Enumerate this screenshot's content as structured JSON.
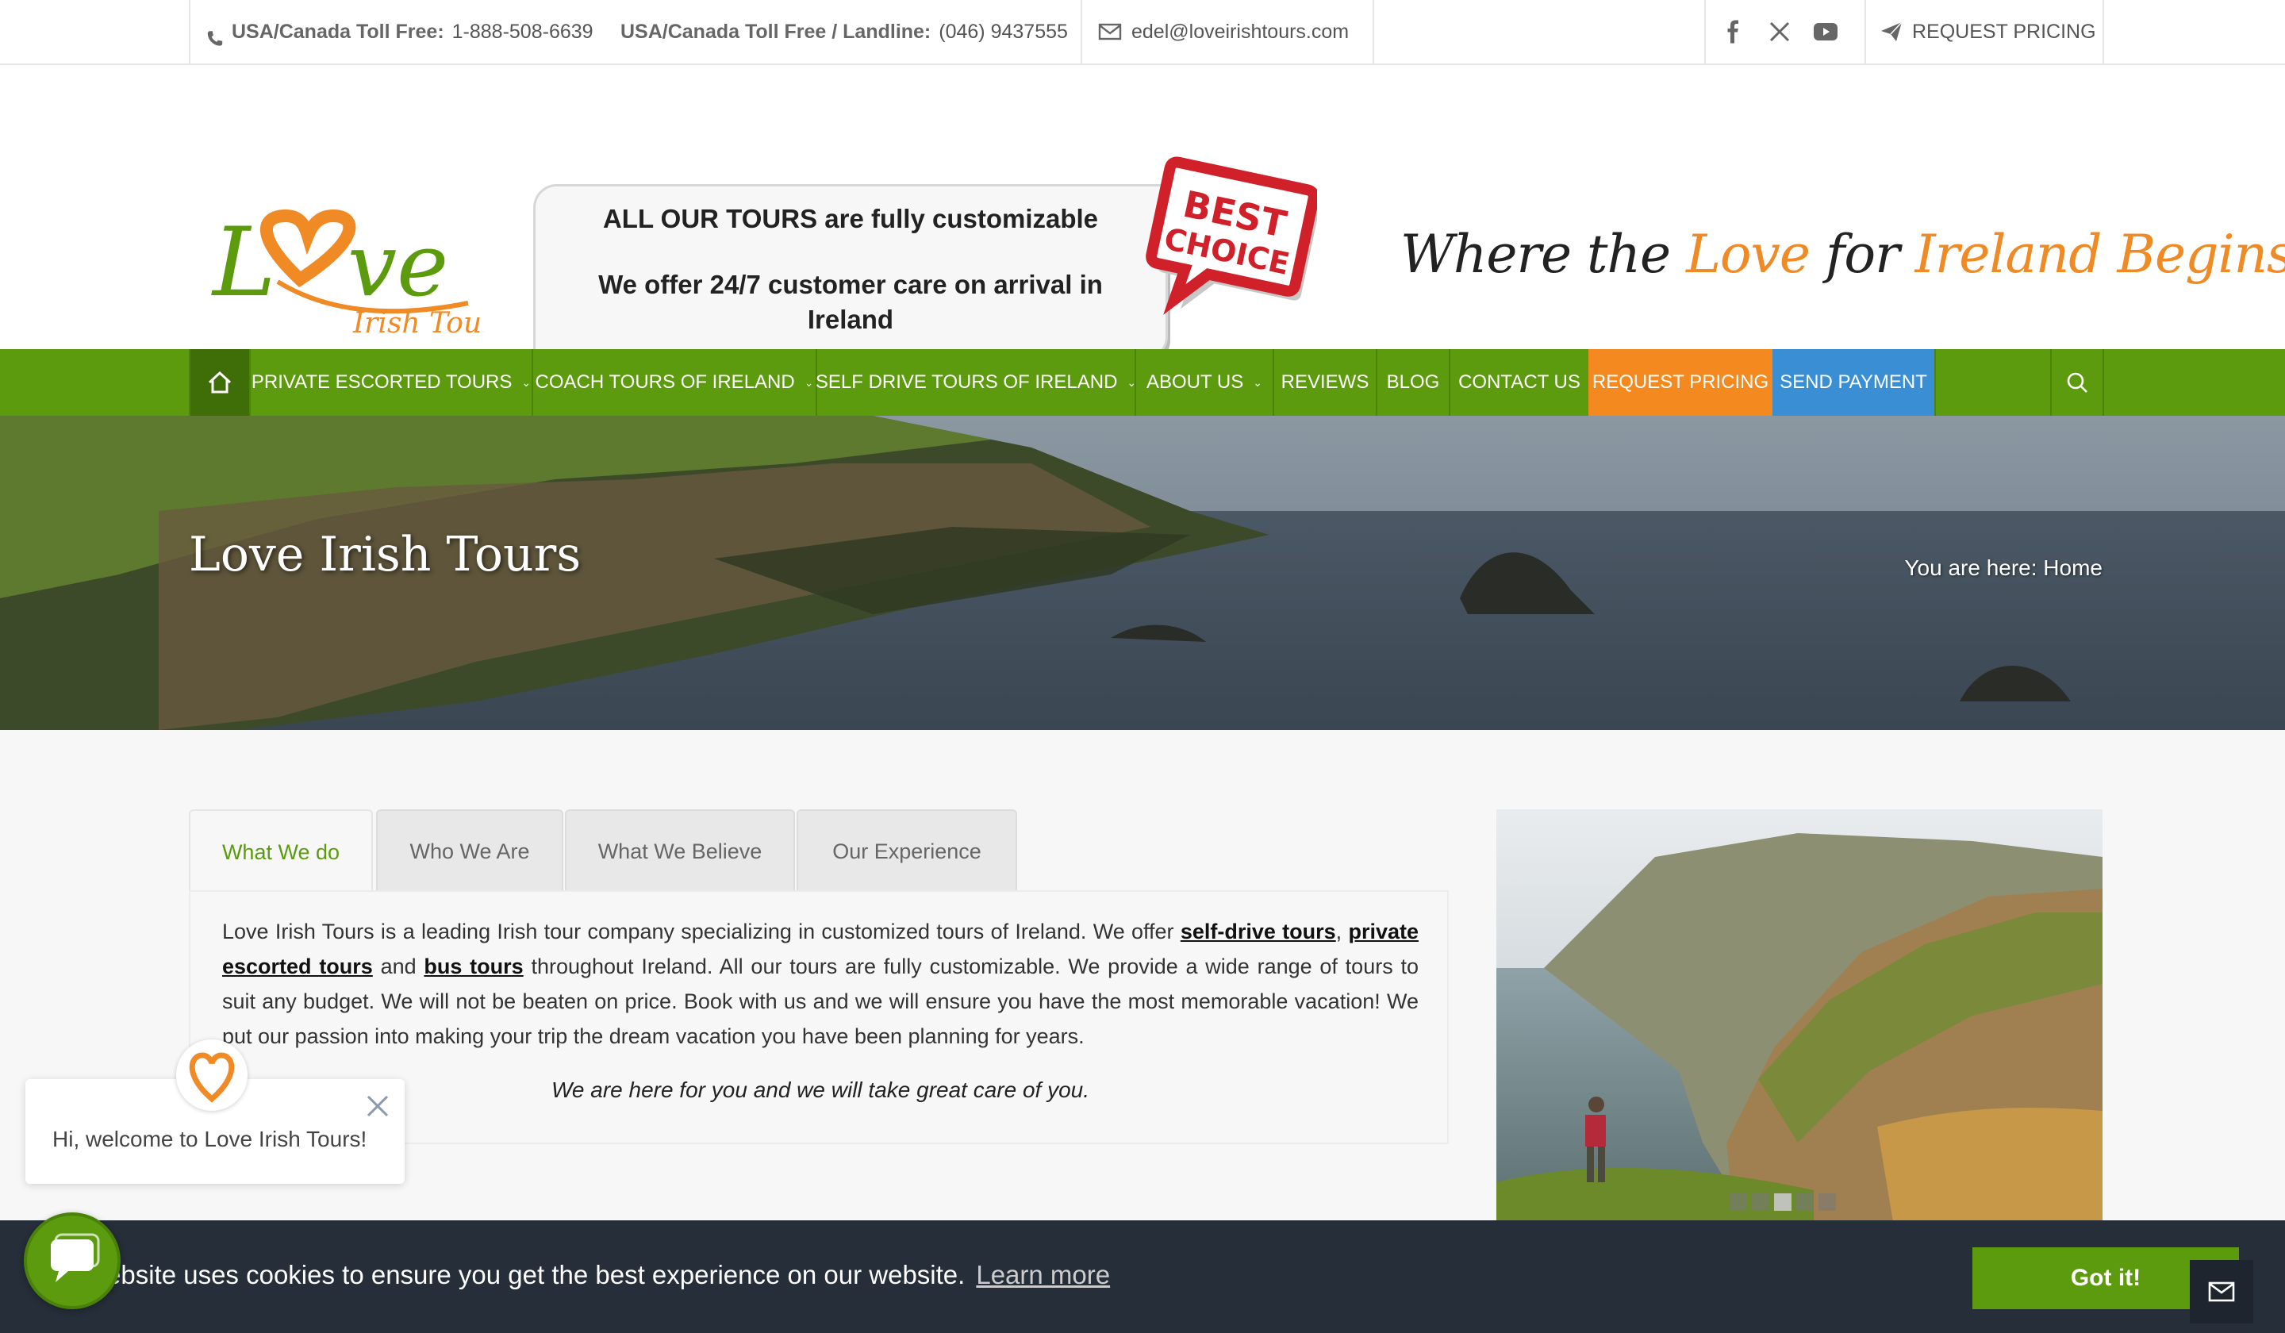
{
  "topbar": {
    "tollfree_label": "USA/Canada Toll Free:",
    "tollfree_number": "1-888-508-6639",
    "landline_label": "USA/Canada Toll Free / Landline:",
    "landline_number": "(046) 9437555",
    "email": "edel@loveirishtours.com",
    "social": [
      "facebook-icon",
      "x-icon",
      "youtube-icon"
    ],
    "request_pricing": "REQUEST PRICING"
  },
  "header": {
    "logo_word": "Love",
    "logo_sub": "Irish Tours",
    "badge_line1": "ALL OUR TOURS are fully customizable",
    "badge_line2": "We offer 24/7 customer care on arrival in Ireland",
    "best_choice_line1": "BEST",
    "best_choice_line2": "CHOICE",
    "tagline_part1": "Where the ",
    "tagline_part2": "Love",
    "tagline_part3": " for ",
    "tagline_part4": "Ireland Begins"
  },
  "nav": {
    "items": [
      {
        "label": "PRIVATE ESCORTED TOURS",
        "dropdown": true
      },
      {
        "label": "COACH TOURS OF IRELAND",
        "dropdown": true
      },
      {
        "label": "SELF DRIVE TOURS OF IRELAND",
        "dropdown": true
      },
      {
        "label": "ABOUT US",
        "dropdown": true
      },
      {
        "label": "REVIEWS"
      },
      {
        "label": "BLOG"
      },
      {
        "label": "CONTACT US"
      },
      {
        "label": "REQUEST PRICING"
      },
      {
        "label": "SEND PAYMENT"
      }
    ]
  },
  "hero": {
    "title": "Love Irish Tours",
    "breadcrumb": "You are here: Home"
  },
  "tabs": {
    "items": [
      "What We do",
      "Who We Are",
      "What We Believe",
      "Our Experience"
    ],
    "active": "What We do",
    "panel": {
      "text_a": "Love Irish Tours is a leading Irish tour company specializing in customized tours of Ireland. We offer ",
      "link_self_drive": "self-drive tours",
      "text_b": ", ",
      "link_private": "private escorted tours",
      "text_c": " and ",
      "link_bus": "bus tours",
      "text_d": " throughout Ireland. All our tours are fully customizable. We provide a wide range of tours to suit any budget. We will not be beaten on price. Book with us and we will ensure you have the most memorable vacation! We put our passion into making your trip the dream vacation you have been planning for years.",
      "quote": "We are here for you and we will take great care of you."
    }
  },
  "slider": {
    "dot_count": 5,
    "active_dot": 3
  },
  "chat": {
    "greeting": "Hi, welcome to Love Irish Tours!"
  },
  "cookie": {
    "text": "ebsite uses cookies to ensure you get the best experience on our website.",
    "learn_more": "Learn more",
    "button": "Got it!"
  },
  "colors": {
    "green": "#5d9b0e",
    "orange": "#f48a1f",
    "blue": "#3a8fd4",
    "cookie_bg": "#252e39"
  }
}
